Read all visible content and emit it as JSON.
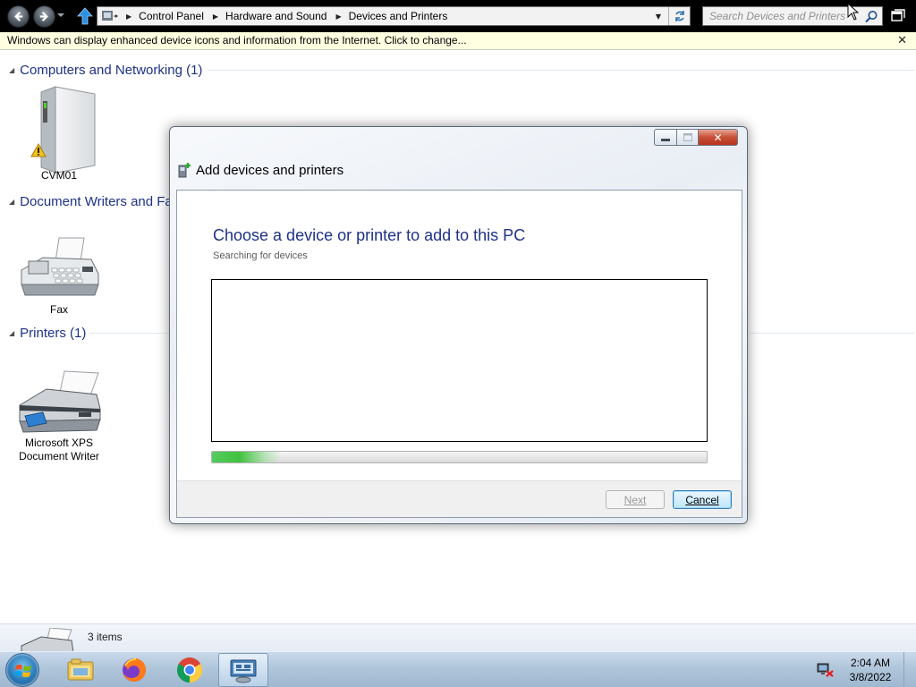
{
  "explorer": {
    "breadcrumb": [
      "Control Panel",
      "Hardware and Sound",
      "Devices and Printers"
    ],
    "search_placeholder": "Search Devices and Printers",
    "info_bar_text": "Windows can display enhanced device icons and information from the Internet. Click to change...",
    "info_bar_close": "✕"
  },
  "groups": [
    {
      "header": "Computers and Networking (1)",
      "devices": [
        {
          "label": "CVM01",
          "icon": "computer-tower-warning-icon"
        }
      ]
    },
    {
      "header": "Document Writers and Fa",
      "devices": [
        {
          "label": "Fax",
          "icon": "fax-icon"
        }
      ]
    },
    {
      "header": "Printers (1)",
      "devices": [
        {
          "label_line1": "Microsoft XPS",
          "label_line2": "Document Writer",
          "icon": "printer-icon"
        }
      ]
    }
  ],
  "status_bar": {
    "text": "3 items"
  },
  "dialog": {
    "title": "Add devices and printers",
    "heading": "Choose a device or printer to add to this PC",
    "subheading": "Searching for devices",
    "progress_fraction": 0.14,
    "next_label": "Next",
    "cancel_label": "Cancel",
    "close_glyph": "✕"
  },
  "taskbar": {
    "apps": [
      "windows-explorer-icon",
      "firefox-icon",
      "chrome-icon",
      "devices-and-printers-icon"
    ],
    "clock_time": "2:04 AM",
    "clock_date": "3/8/2022"
  },
  "colors": {
    "heading_blue": "#1e3287",
    "info_bar_bg": "#ffffe1",
    "progress_green": "#3fc23f",
    "close_red": "#c74f36"
  }
}
